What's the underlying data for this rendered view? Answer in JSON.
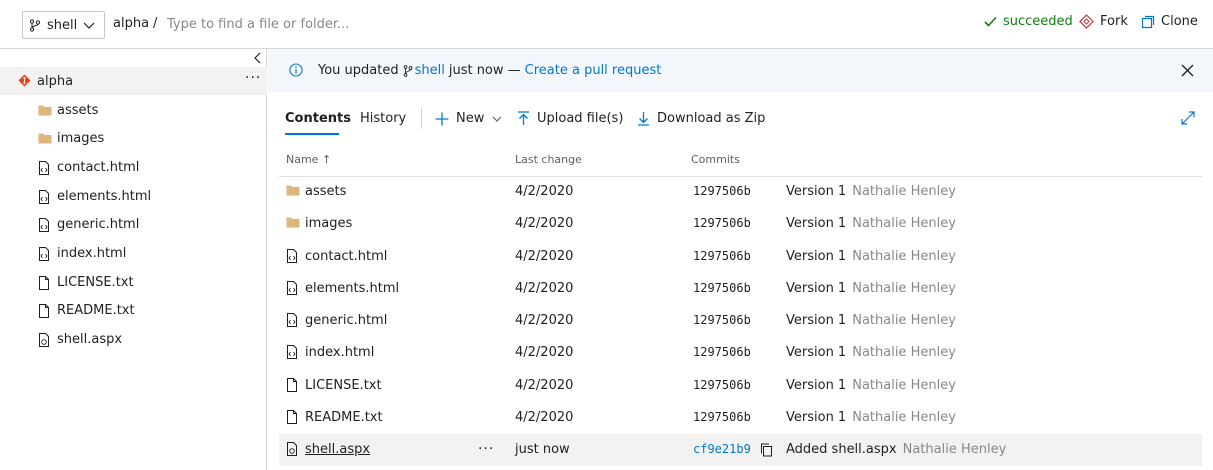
{
  "header": {
    "branch": "shell",
    "repo": "alpha",
    "separator": "/",
    "path_placeholder": "Type to find a file or folder...",
    "status": "succeeded",
    "fork_label": "Fork",
    "clone_label": "Clone"
  },
  "sidebar": {
    "root": "alpha",
    "more": "···",
    "items": [
      {
        "label": "assets",
        "icon": "folder-icon"
      },
      {
        "label": "images",
        "icon": "folder-icon"
      },
      {
        "label": "contact.html",
        "icon": "code-file-icon"
      },
      {
        "label": "elements.html",
        "icon": "code-file-icon"
      },
      {
        "label": "generic.html",
        "icon": "code-file-icon"
      },
      {
        "label": "index.html",
        "icon": "code-file-icon"
      },
      {
        "label": "LICENSE.txt",
        "icon": "file-icon"
      },
      {
        "label": "README.txt",
        "icon": "file-icon"
      },
      {
        "label": "shell.aspx",
        "icon": "code-file-icon"
      }
    ]
  },
  "banner": {
    "prefix": "You updated",
    "branch": "shell",
    "suffix": "just now —",
    "link": "Create a pull request"
  },
  "tabs": {
    "contents": "Contents",
    "history": "History"
  },
  "toolbar": {
    "new": "New",
    "upload": "Upload file(s)",
    "download": "Download as Zip"
  },
  "table": {
    "headers": {
      "name": "Name",
      "sort_arrow": "↑",
      "last_change": "Last change",
      "commits": "Commits"
    },
    "rows": [
      {
        "name": "assets",
        "date": "4/2/2020",
        "hash": "1297506b",
        "message": "Version 1",
        "author": "Nathalie Henley",
        "icon": "folder-icon"
      },
      {
        "name": "images",
        "date": "4/2/2020",
        "hash": "1297506b",
        "message": "Version 1",
        "author": "Nathalie Henley",
        "icon": "folder-icon"
      },
      {
        "name": "contact.html",
        "date": "4/2/2020",
        "hash": "1297506b",
        "message": "Version 1",
        "author": "Nathalie Henley",
        "icon": "code-file-icon"
      },
      {
        "name": "elements.html",
        "date": "4/2/2020",
        "hash": "1297506b",
        "message": "Version 1",
        "author": "Nathalie Henley",
        "icon": "code-file-icon"
      },
      {
        "name": "generic.html",
        "date": "4/2/2020",
        "hash": "1297506b",
        "message": "Version 1",
        "author": "Nathalie Henley",
        "icon": "code-file-icon"
      },
      {
        "name": "index.html",
        "date": "4/2/2020",
        "hash": "1297506b",
        "message": "Version 1",
        "author": "Nathalie Henley",
        "icon": "code-file-icon"
      },
      {
        "name": "LICENSE.txt",
        "date": "4/2/2020",
        "hash": "1297506b",
        "message": "Version 1",
        "author": "Nathalie Henley",
        "icon": "file-icon"
      },
      {
        "name": "README.txt",
        "date": "4/2/2020",
        "hash": "1297506b",
        "message": "Version 1",
        "author": "Nathalie Henley",
        "icon": "file-icon"
      },
      {
        "name": "shell.aspx",
        "date": "just now",
        "hash": "cf9e21b9",
        "message": "Added shell.aspx",
        "author": "Nathalie Henley",
        "icon": "code-file-icon",
        "more": "···"
      }
    ]
  },
  "colors": {
    "accent": "#0078d4",
    "success": "#107c10",
    "fork": "#d13438",
    "folder": "#dcb67a",
    "repo": "#e8411d"
  }
}
